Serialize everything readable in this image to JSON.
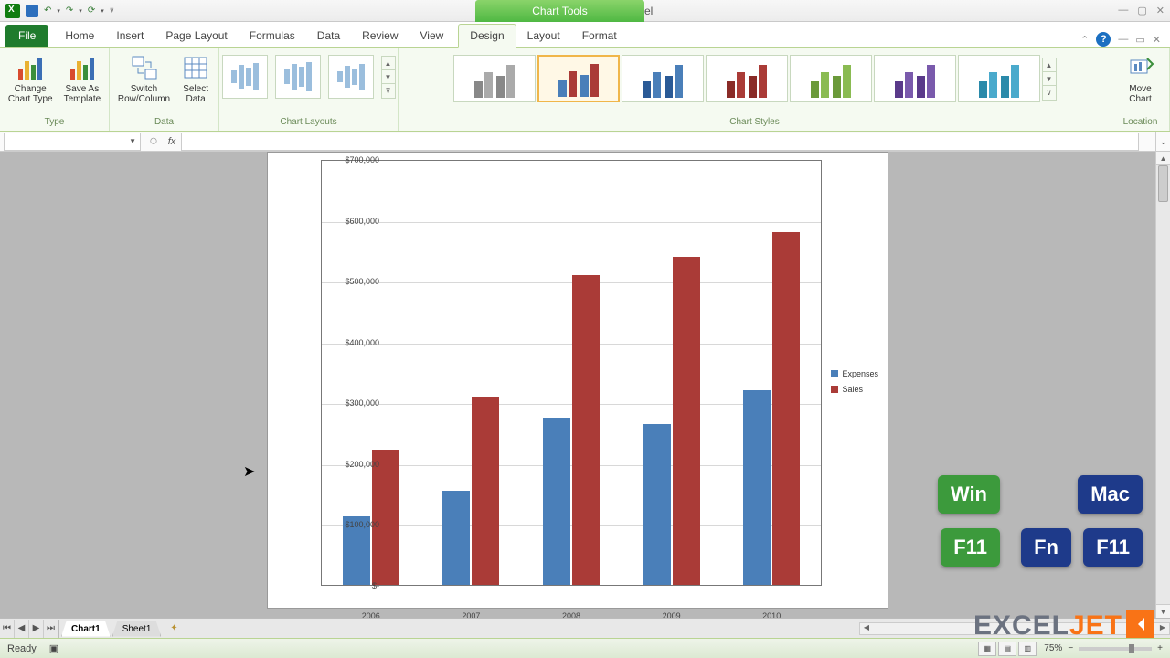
{
  "titlebar": {
    "title": "charts.xlsx - Microsoft Excel",
    "chart_tools": "Chart Tools"
  },
  "tabs": {
    "file": "File",
    "main": [
      "Home",
      "Insert",
      "Page Layout",
      "Formulas",
      "Data",
      "Review",
      "View"
    ],
    "context": [
      "Design",
      "Layout",
      "Format"
    ],
    "active": "Design"
  },
  "ribbon": {
    "type": {
      "change": "Change\nChart Type",
      "save_as": "Save As\nTemplate",
      "label": "Type"
    },
    "data": {
      "switch": "Switch\nRow/Column",
      "select": "Select\nData",
      "label": "Data"
    },
    "layouts_label": "Chart Layouts",
    "styles_label": "Chart Styles",
    "location": {
      "move": "Move\nChart",
      "label": "Location"
    }
  },
  "chart_data": {
    "type": "bar",
    "categories": [
      "2006",
      "2007",
      "2008",
      "2009",
      "2010"
    ],
    "series": [
      {
        "name": "Expenses",
        "values": [
          112000,
          155000,
          275000,
          265000,
          320000
        ],
        "color": "#4a7fb9"
      },
      {
        "name": "Sales",
        "values": [
          222000,
          310000,
          510000,
          540000,
          580000
        ],
        "color": "#aa3b37"
      }
    ],
    "ylim": [
      0,
      700000
    ],
    "ytick_labels": [
      "$700,000",
      "$600,000",
      "$500,000",
      "$400,000",
      "$300,000",
      "$200,000",
      "$100,000",
      "$-"
    ],
    "ytick_values": [
      700000,
      600000,
      500000,
      400000,
      300000,
      200000,
      100000,
      0
    ]
  },
  "sheet_tabs": {
    "active": "Chart1",
    "other": "Sheet1"
  },
  "statusbar": {
    "ready": "Ready",
    "zoom": "75%"
  },
  "overlay": {
    "win": "Win",
    "mac": "Mac",
    "f11": "F11",
    "fn": "Fn",
    "brand1": "EXCEL",
    "brand2": "JET"
  }
}
